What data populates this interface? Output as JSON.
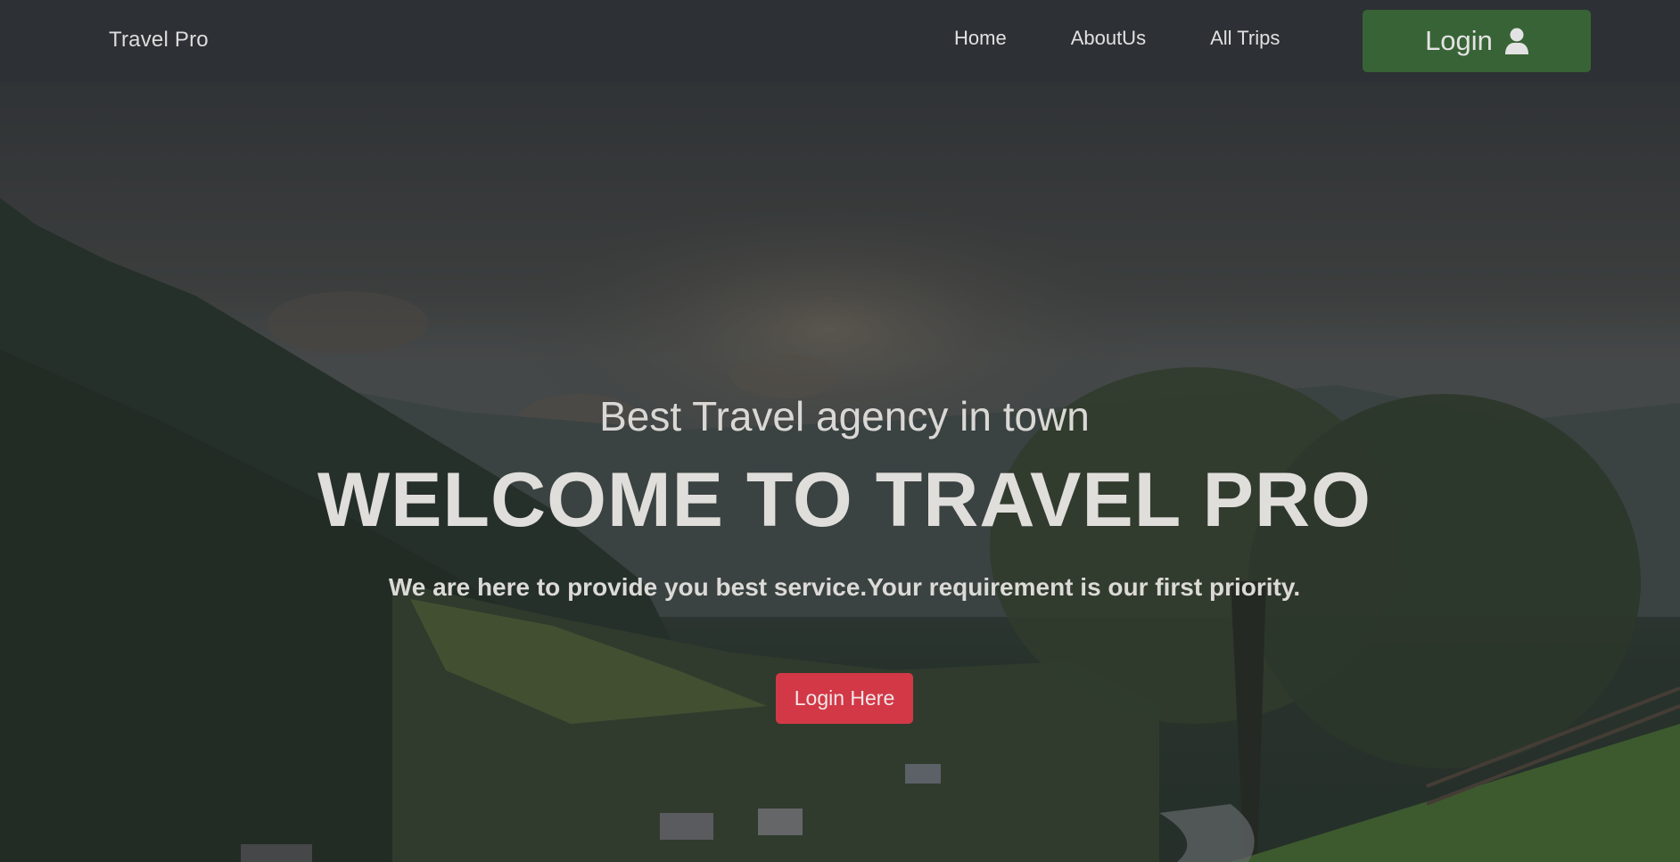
{
  "navbar": {
    "brand": "Travel Pro",
    "links": [
      "Home",
      "AboutUs",
      "All Trips"
    ],
    "login_label": "Login",
    "login_icon": "user-icon"
  },
  "hero": {
    "tagline": "Best Travel agency in town",
    "headline": "WELCOME TO TRAVEL PRO",
    "subtext": "We are here to provide you best service.Your requirement is our first priority.",
    "cta_label": "Login Here"
  },
  "colors": {
    "navbar_bg": "#2d3034",
    "login_button": "#386336",
    "cta_button": "#d33847",
    "hero_text": "#dedcda"
  }
}
